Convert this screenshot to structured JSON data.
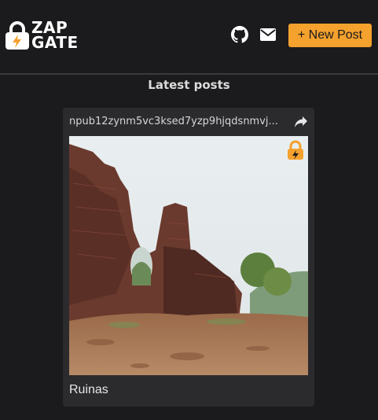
{
  "header": {
    "logo_line1": "ZAP",
    "logo_line2": "GATE",
    "new_post_label": "+ New Post"
  },
  "icons": {
    "logo": "lock-bolt-icon",
    "github": "github-icon",
    "mail": "envelope-icon",
    "share": "share-icon",
    "locked_badge": "lock-icon"
  },
  "colors": {
    "background": "#1b1b1d",
    "card": "#2b2b2e",
    "accent": "#f5a12e"
  },
  "main": {
    "section_title": "Latest posts",
    "posts": [
      {
        "author": "npub12zynm5vc3ksed7yzp9hjqdsnmvj...",
        "title": "Ruinas"
      }
    ]
  }
}
